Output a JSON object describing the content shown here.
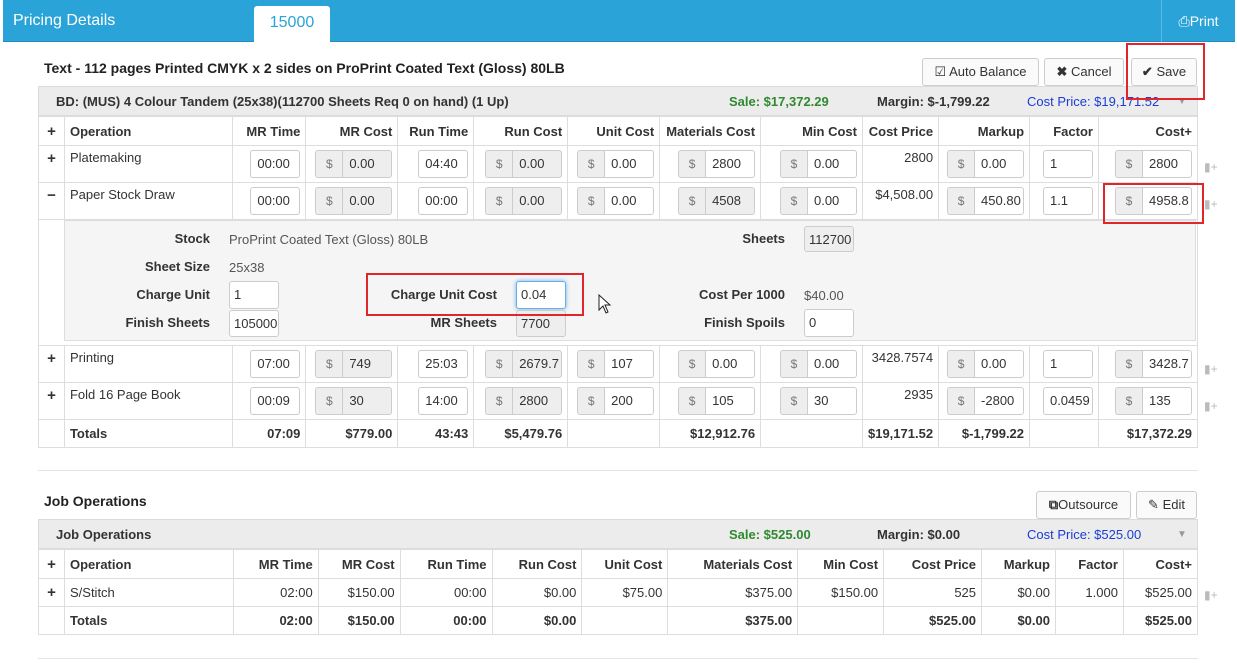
{
  "header": {
    "title": "Pricing Details",
    "tab": "15000",
    "print": "Print"
  },
  "section1": {
    "title": "Text - 112 pages Printed CMYK x 2 sides on ProPrint Coated Text (Gloss) 80LB",
    "buttons": {
      "auto_balance": "Auto Balance",
      "cancel": "Cancel",
      "save": "Save"
    },
    "bar": {
      "label": "BD: (MUS) 4 Colour Tandem (25x38)(112700 Sheets Req 0 on hand) (1 Up)",
      "sale": "Sale: $17,372.29",
      "margin": "Margin: $-1,799.22",
      "cost_price": "Cost Price: $19,171.52"
    },
    "columns": [
      "Operation",
      "MR Time",
      "MR Cost",
      "Run Time",
      "Run Cost",
      "Unit Cost",
      "Materials Cost",
      "Min Cost",
      "Cost Price",
      "Markup",
      "Factor",
      "Cost+"
    ],
    "rows": [
      {
        "toggle": "+",
        "op": "Platemaking",
        "mr_time": "00:00",
        "mr_cost": "0.00",
        "run_time": "04:40",
        "run_cost": "0.00",
        "unit_cost": "0.00",
        "materials": "2800",
        "min_cost": "0.00",
        "cost_price": "2800",
        "markup": "0.00",
        "factor": "1",
        "cost_plus": "2800"
      },
      {
        "toggle": "−",
        "op": "Paper Stock Draw",
        "mr_time": "00:00",
        "mr_cost": "0.00",
        "run_time": "00:00",
        "run_cost": "0.00",
        "unit_cost": "0.00",
        "materials": "4508",
        "min_cost": "0.00",
        "cost_price": "$4,508.00",
        "markup": "450.80",
        "factor": "1.1",
        "cost_plus": "4958.8"
      },
      {
        "toggle": "+",
        "op": "Printing",
        "mr_time": "07:00",
        "mr_cost": "749",
        "run_time": "25:03",
        "run_cost": "2679.7",
        "unit_cost": "107",
        "materials": "0.00",
        "min_cost": "0.00",
        "cost_price": "3428.7574",
        "markup": "0.00",
        "factor": "1",
        "cost_plus": "3428.7"
      },
      {
        "toggle": "+",
        "op": "Fold 16 Page Book",
        "mr_time": "00:09",
        "mr_cost": "30",
        "run_time": "14:00",
        "run_cost": "2800",
        "unit_cost": "200",
        "materials": "105",
        "min_cost": "30",
        "cost_price": "2935",
        "markup": "-2800",
        "factor": "0.0459",
        "cost_plus": "135"
      }
    ],
    "totals": {
      "label": "Totals",
      "mr_time": "07:09",
      "mr_cost": "$779.00",
      "run_time": "43:43",
      "run_cost": "$5,479.76",
      "materials": "$12,912.76",
      "cost_price": "$19,171.52",
      "markup": "$-1,799.22",
      "cost_plus": "$17,372.29"
    },
    "detail": {
      "stock_label": "Stock",
      "stock_value": "ProPrint Coated Text (Gloss) 80LB",
      "sheets_label": "Sheets",
      "sheets_value": "112700",
      "sheet_size_label": "Sheet Size",
      "sheet_size_value": "25x38",
      "charge_unit_label": "Charge Unit",
      "charge_unit_value": "1",
      "charge_unit_cost_label": "Charge Unit Cost",
      "charge_unit_cost_value": "0.04",
      "cost_per_1000_label": "Cost Per 1000",
      "cost_per_1000_value": "$40.00",
      "finish_sheets_label": "Finish Sheets",
      "finish_sheets_value": "105000",
      "mr_sheets_label": "MR Sheets",
      "mr_sheets_value": "7700",
      "finish_spoils_label": "Finish Spoils",
      "finish_spoils_value": "0"
    }
  },
  "section2": {
    "title": "Job Operations",
    "buttons": {
      "outsource": "Outsource",
      "edit": "Edit"
    },
    "bar": {
      "label": "Job Operations",
      "sale": "Sale: $525.00",
      "margin": "Margin: $0.00",
      "cost_price": "Cost Price: $525.00"
    },
    "columns": [
      "Operation",
      "MR Time",
      "MR Cost",
      "Run Time",
      "Run Cost",
      "Unit Cost",
      "Materials Cost",
      "Min Cost",
      "Cost Price",
      "Markup",
      "Factor",
      "Cost+"
    ],
    "rows": [
      {
        "toggle": "+",
        "op": "S/Stitch",
        "mr_time": "02:00",
        "mr_cost": "$150.00",
        "run_time": "00:00",
        "run_cost": "$0.00",
        "unit_cost": "$75.00",
        "materials": "$375.00",
        "min_cost": "$150.00",
        "cost_price": "525",
        "markup": "$0.00",
        "factor": "1.000",
        "cost_plus": "$525.00"
      }
    ],
    "totals": {
      "label": "Totals",
      "mr_time": "02:00",
      "mr_cost": "$150.00",
      "run_time": "00:00",
      "run_cost": "$0.00",
      "materials": "$375.00",
      "cost_price": "$525.00",
      "markup": "$0.00",
      "cost_plus": "$525.00"
    }
  },
  "colors": {
    "header": "#29a3d8",
    "green": "#2f8a2f",
    "blue": "#1a3dd6",
    "highlight": "#e0262a"
  }
}
